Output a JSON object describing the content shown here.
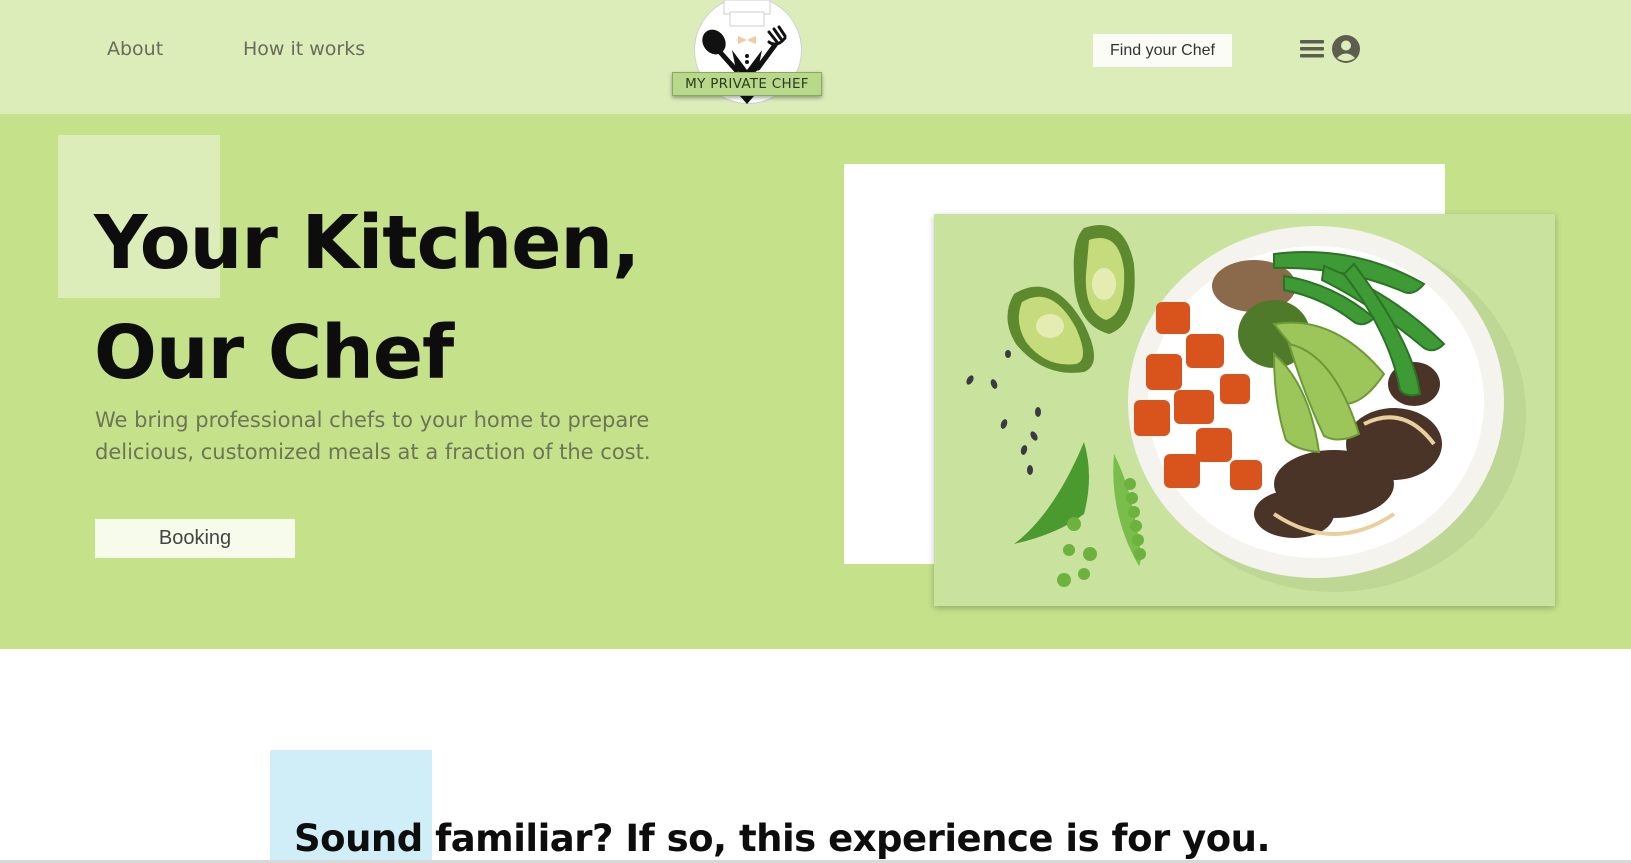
{
  "nav": {
    "about": "About",
    "how_it_works": "How it works",
    "find_chef": "Find your Chef",
    "menu_icon": "hamburger-menu-icon",
    "account_icon": "user-account-icon"
  },
  "logo": {
    "text": "MY PRIVATE CHEF",
    "icon": "chef-utensils-logo"
  },
  "hero": {
    "title": "Your Kitchen, Our Chef",
    "subtitle": "We bring professional chefs to your home to prepare delicious, customized meals at a fraction of the cost.",
    "booking_label": "Booking",
    "image": "food-bowl-image"
  },
  "section": {
    "title": "Sound familiar? If so, this experience is for you."
  },
  "colors": {
    "header_bg": "#dcedba",
    "hero_bg": "#c5e18a",
    "accent_square": "#d0eef8"
  }
}
